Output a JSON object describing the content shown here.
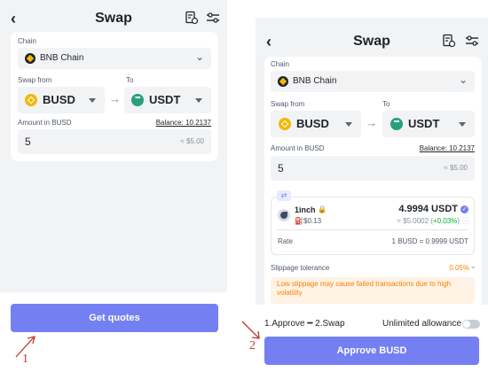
{
  "left": {
    "title": "Swap",
    "chain_label": "Chain",
    "chain_value": "BNB Chain",
    "swap_from_label": "Swap from",
    "to_label": "To",
    "from_token": "BUSD",
    "to_token": "USDT",
    "amount_label": "Amount in BUSD",
    "balance": "Balance: 10.2137",
    "amount_value": "5",
    "amount_usd": "≈ $5.00",
    "button": "Get quotes",
    "step_marker": "1"
  },
  "right": {
    "title": "Swap",
    "chain_label": "Chain",
    "chain_value": "BNB Chain",
    "swap_from_label": "Swap from",
    "to_label": "To",
    "from_token": "BUSD",
    "to_token": "USDT",
    "amount_label": "Amount in BUSD",
    "balance": "Balance: 10.2137",
    "amount_value": "5",
    "amount_usd": "≈ $5.00",
    "quote": {
      "provider": "1inch",
      "gas": "$0.13",
      "amount": "4.9994 USDT",
      "usd_prefix": "≈ $5.0002 (",
      "delta": "+0.03%",
      "usd_suffix": ")",
      "rate_label": "Rate",
      "rate_value": "1 BUSD = 0.9999 USDT"
    },
    "slippage_label": "Slippage tolerance",
    "slippage_value": "0.05%",
    "slippage_warning": "Low slippage may cause failed transactions due to high volatility",
    "steps_text": "1.Approve ━ 2.Swap",
    "allowance_label": "Unlimited allowance",
    "button": "Approve BUSD",
    "step_marker": "2"
  },
  "colors": {
    "accent": "#7480f2",
    "busd": "#f0b90b",
    "usdt": "#26a17b",
    "positive": "#00b42a",
    "warning": "#ff7d00"
  }
}
